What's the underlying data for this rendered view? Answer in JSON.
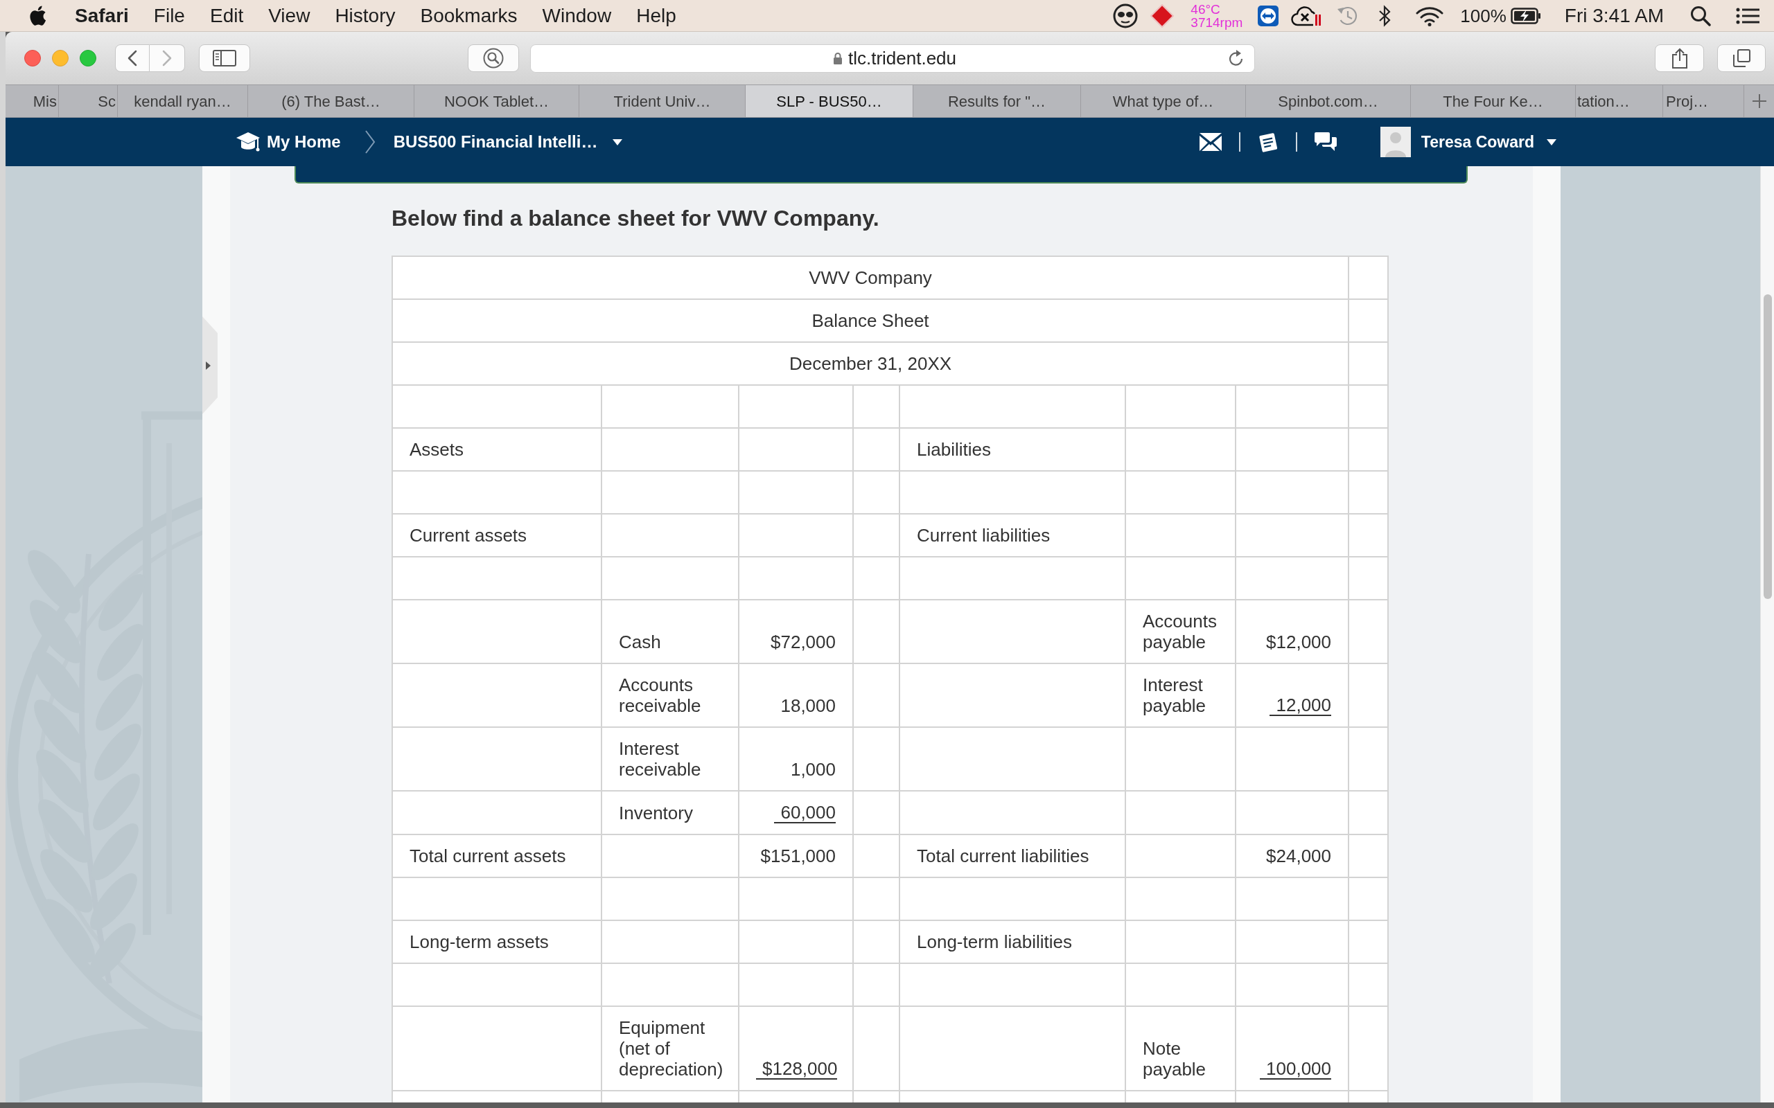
{
  "menu_bar": {
    "app_name": "Safari",
    "menus": [
      "File",
      "Edit",
      "View",
      "History",
      "Bookmarks",
      "Window",
      "Help"
    ],
    "temperature": "46°C",
    "fan_speed": "3714rpm",
    "battery": "100%",
    "clock": "Fri 3:41 AM"
  },
  "browser": {
    "address": "tlc.trident.edu",
    "tabs": [
      {
        "label": "Mis",
        "selected": false
      },
      {
        "label": "Sc",
        "selected": false
      },
      {
        "label": "kendall ryan…",
        "selected": false
      },
      {
        "label": "(6) The Bast…",
        "selected": false
      },
      {
        "label": "NOOK Tablet…",
        "selected": false
      },
      {
        "label": "Trident Univ…",
        "selected": false
      },
      {
        "label": "SLP - BUS50…",
        "selected": true
      },
      {
        "label": "Results for \"…",
        "selected": false
      },
      {
        "label": "What type of…",
        "selected": false
      },
      {
        "label": "Spinbot.com…",
        "selected": false
      },
      {
        "label": "The Four Ke…",
        "selected": false
      },
      {
        "label": "tation…",
        "selected": false
      },
      {
        "label": "Proj…",
        "selected": false
      }
    ]
  },
  "site_nav": {
    "breadcrumbs": [
      "My Home",
      "BUS500 Financial Intelli…"
    ],
    "user_name": "Teresa Coward"
  },
  "page": {
    "heading": "Below find a balance sheet for VWV Company.",
    "balance_sheet": {
      "title_lines": [
        "VWV Company",
        "Balance Sheet",
        "December 31, 20XX"
      ],
      "rows": [
        {
          "kind": "blank"
        },
        {
          "kind": "section",
          "asset_label": "Assets",
          "liability_label": "Liabilities"
        },
        {
          "kind": "blank"
        },
        {
          "kind": "section",
          "asset_label": "Current assets",
          "liability_label": "Current liabilities"
        },
        {
          "kind": "blank"
        },
        {
          "kind": "entry",
          "asset_item": "Cash",
          "asset_amount": {
            "text": "$72,000",
            "underlined": false
          },
          "liability_item": "Accounts payable",
          "liability_amount": {
            "text": "$12,000",
            "underlined": false
          }
        },
        {
          "kind": "entry",
          "asset_item": "Accounts receivable",
          "asset_amount": {
            "text": "18,000",
            "underlined": false
          },
          "liability_item": "Interest payable",
          "liability_amount": {
            "text": "12,000",
            "underlined": true
          }
        },
        {
          "kind": "entry",
          "asset_item": "Interest receivable",
          "asset_amount": {
            "text": "1,000",
            "underlined": false
          }
        },
        {
          "kind": "entry",
          "asset_item": "Inventory",
          "asset_amount": {
            "text": "60,000",
            "underlined": true
          }
        },
        {
          "kind": "total",
          "asset_label": "Total current assets",
          "asset_amount": {
            "text": "$151,000",
            "underlined": false
          },
          "liability_label": "Total current liabilities",
          "liability_amount": {
            "text": "$24,000",
            "underlined": false
          }
        },
        {
          "kind": "blank"
        },
        {
          "kind": "section",
          "asset_label": "Long-term assets",
          "liability_label": "Long-term liabilities"
        },
        {
          "kind": "blank"
        },
        {
          "kind": "entry",
          "asset_item": "Equipment (net of depreciation)",
          "asset_amount": {
            "text": "$128,000",
            "underlined": true
          },
          "liability_item": "Note payable",
          "liability_amount": {
            "text": "100,000",
            "underlined": true
          }
        },
        {
          "kind": "blank"
        }
      ]
    }
  }
}
